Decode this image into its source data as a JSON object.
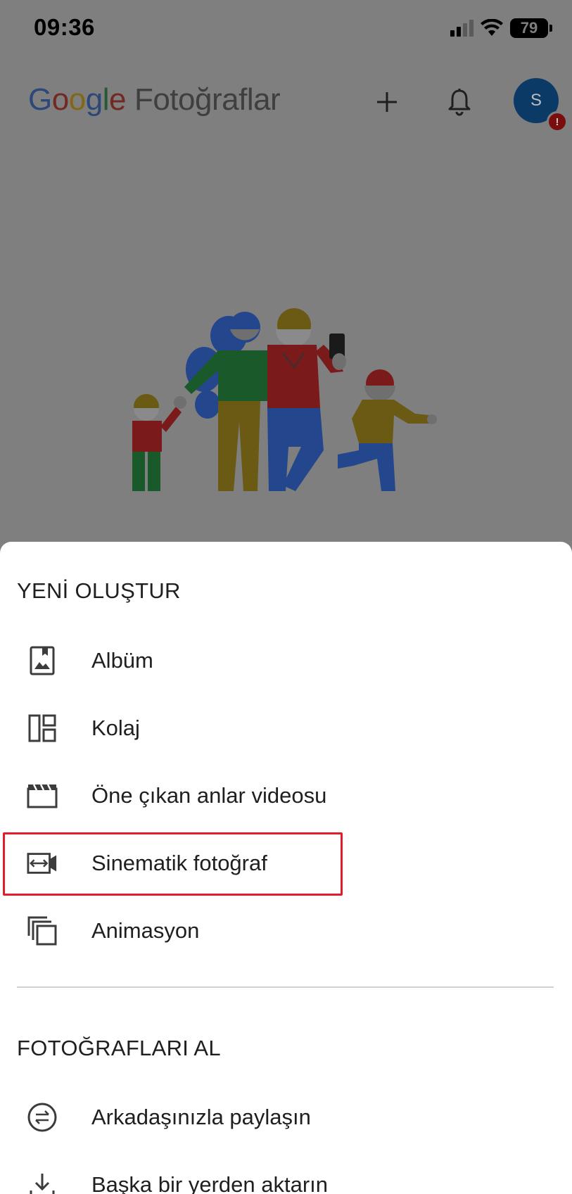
{
  "status_bar": {
    "time": "09:36",
    "battery": "79",
    "icons": [
      "signal-icon",
      "wifi-icon",
      "battery-icon"
    ]
  },
  "header": {
    "logo_google": [
      "G",
      "o",
      "o",
      "g",
      "l",
      "e"
    ],
    "logo_colors": [
      "#4285F4",
      "#EA4335",
      "#FBBC05",
      "#4285F4",
      "#34A853",
      "#EA4335"
    ],
    "product_name": "Fotoğraflar",
    "avatar_initial": "S",
    "avatar_badge": "!",
    "icons": [
      "plus-icon",
      "bell-icon"
    ]
  },
  "sheet": {
    "create_section_title": "YENİ OLUŞTUR",
    "create_items": [
      {
        "label": "Albüm",
        "icon": "album-icon"
      },
      {
        "label": "Kolaj",
        "icon": "collage-icon"
      },
      {
        "label": "Öne çıkan anlar videosu",
        "icon": "movie-clapper-icon"
      },
      {
        "label": "Sinematik fotoğraf",
        "icon": "cinematic-icon"
      },
      {
        "label": "Animasyon",
        "icon": "animation-icon"
      }
    ],
    "import_section_title": "FOTOĞRAFLARI AL",
    "import_items": [
      {
        "label": "Arkadaşınızla paylaşın",
        "icon": "share-swap-icon"
      },
      {
        "label": "Başka bir yerden aktarın",
        "icon": "download-icon"
      }
    ]
  },
  "colors": {
    "highlight": "#e01e2b",
    "scrim": "#7f7f7f",
    "avatar_bg": "#0c3a66"
  }
}
